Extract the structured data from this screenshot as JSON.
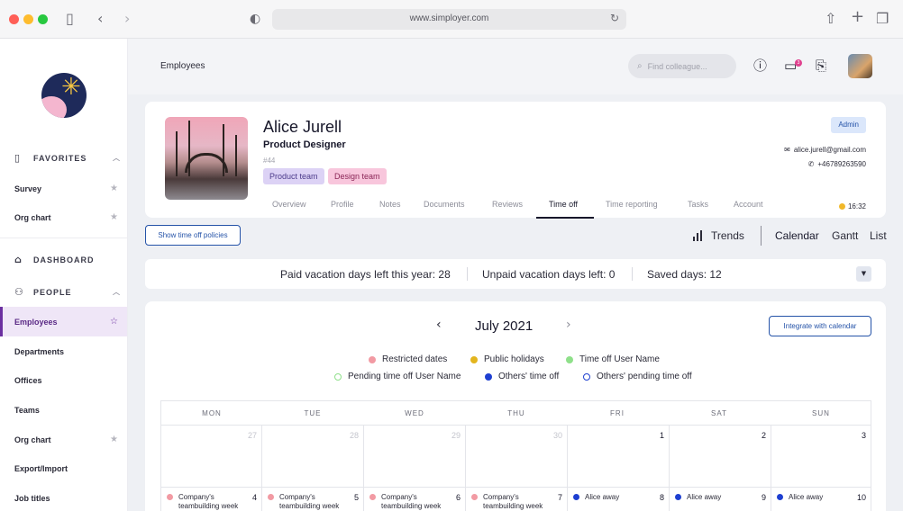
{
  "browser": {
    "url": "www.simployer.com"
  },
  "icons": {
    "sidebar_toggle": "sidebar-icon",
    "back": "chevron-left-icon",
    "forward": "chevron-right-icon",
    "shield": "shield-icon",
    "reload": "reload-icon",
    "share": "share-icon",
    "new_tab": "plus-icon",
    "tabs": "tabs-icon"
  },
  "colors": {
    "accent": "#2553a8",
    "active_nav": "#6b2fa0",
    "restricted": "#f29aa3",
    "public_holiday": "#e3b51e",
    "time_off_user": "#8fe08a",
    "others_time_off": "#1e3fd1"
  },
  "sidebar": {
    "favorites_label": "FAVORITES",
    "favorites": [
      {
        "label": "Survey"
      },
      {
        "label": "Org chart"
      }
    ],
    "dashboard_label": "DASHBOARD",
    "people_label": "PEOPLE",
    "people": [
      {
        "label": "Employees",
        "active": true
      },
      {
        "label": "Departments"
      },
      {
        "label": "Offices"
      },
      {
        "label": "Teams"
      },
      {
        "label": "Org chart"
      },
      {
        "label": "Export/Import"
      },
      {
        "label": "Job titles"
      }
    ]
  },
  "header": {
    "breadcrumb": "Employees",
    "search_placeholder": "Find colleague...",
    "notification_count": "3"
  },
  "profile": {
    "name": "Alice Jurell",
    "title": "Product Designer",
    "id": "#44",
    "tags": [
      "Product team",
      "Design team"
    ],
    "role_badge": "Admin",
    "email": "alice.jurell@gmail.com",
    "phone": "+46789263590",
    "local_time": "16:32",
    "tabs": [
      "Overview",
      "Profile",
      "Notes",
      "Documents",
      "Reviews",
      "Time off",
      "Time reporting",
      "Tasks",
      "Account"
    ],
    "active_tab": "Time off"
  },
  "timeoff": {
    "policies_button": "Show time off policies",
    "views": [
      "Trends",
      "Calendar",
      "Gantt",
      "List"
    ],
    "active_view": "Calendar",
    "summary": {
      "paid": "Paid vacation days left this year: 28",
      "unpaid": "Unpaid vacation days left: 0",
      "saved": "Saved days: 12"
    },
    "calendar": {
      "month": "July 2021",
      "integrate_button": "Integrate with calendar",
      "legend": [
        {
          "label": "Restricted dates",
          "color": "#f29aa3",
          "style": "filled"
        },
        {
          "label": "Public holidays",
          "color": "#e3b51e",
          "style": "filled"
        },
        {
          "label": "Time off User Name",
          "color": "#8fe08a",
          "style": "filled"
        },
        {
          "label": "Pending time off User Name",
          "color": "#8fe08a",
          "style": "outline"
        },
        {
          "label": "Others' time off",
          "color": "#1e3fd1",
          "style": "filled"
        },
        {
          "label": "Others' pending time off",
          "color": "#1e3fd1",
          "style": "outline"
        }
      ],
      "weekdays": [
        "MON",
        "TUE",
        "WED",
        "THU",
        "FRI",
        "SAT",
        "SUN"
      ],
      "week1": [
        "27",
        "28",
        "29",
        "30",
        "1",
        "2",
        "3"
      ],
      "week2": [
        "4",
        "5",
        "6",
        "7",
        "8",
        "9",
        "10"
      ],
      "week2_events": [
        {
          "text": "Company's teambuilding week",
          "color": "#f29aa3"
        },
        {
          "text": "Company's teambuilding week",
          "color": "#f29aa3"
        },
        {
          "text": "Company's teambuilding week",
          "color": "#f29aa3"
        },
        {
          "text": "Company's teambuilding week",
          "color": "#f29aa3"
        },
        {
          "text": "Alice away",
          "color": "#1e3fd1"
        },
        {
          "text": "Alice away",
          "color": "#1e3fd1"
        },
        {
          "text": "Alice away",
          "color": "#1e3fd1"
        }
      ]
    }
  }
}
